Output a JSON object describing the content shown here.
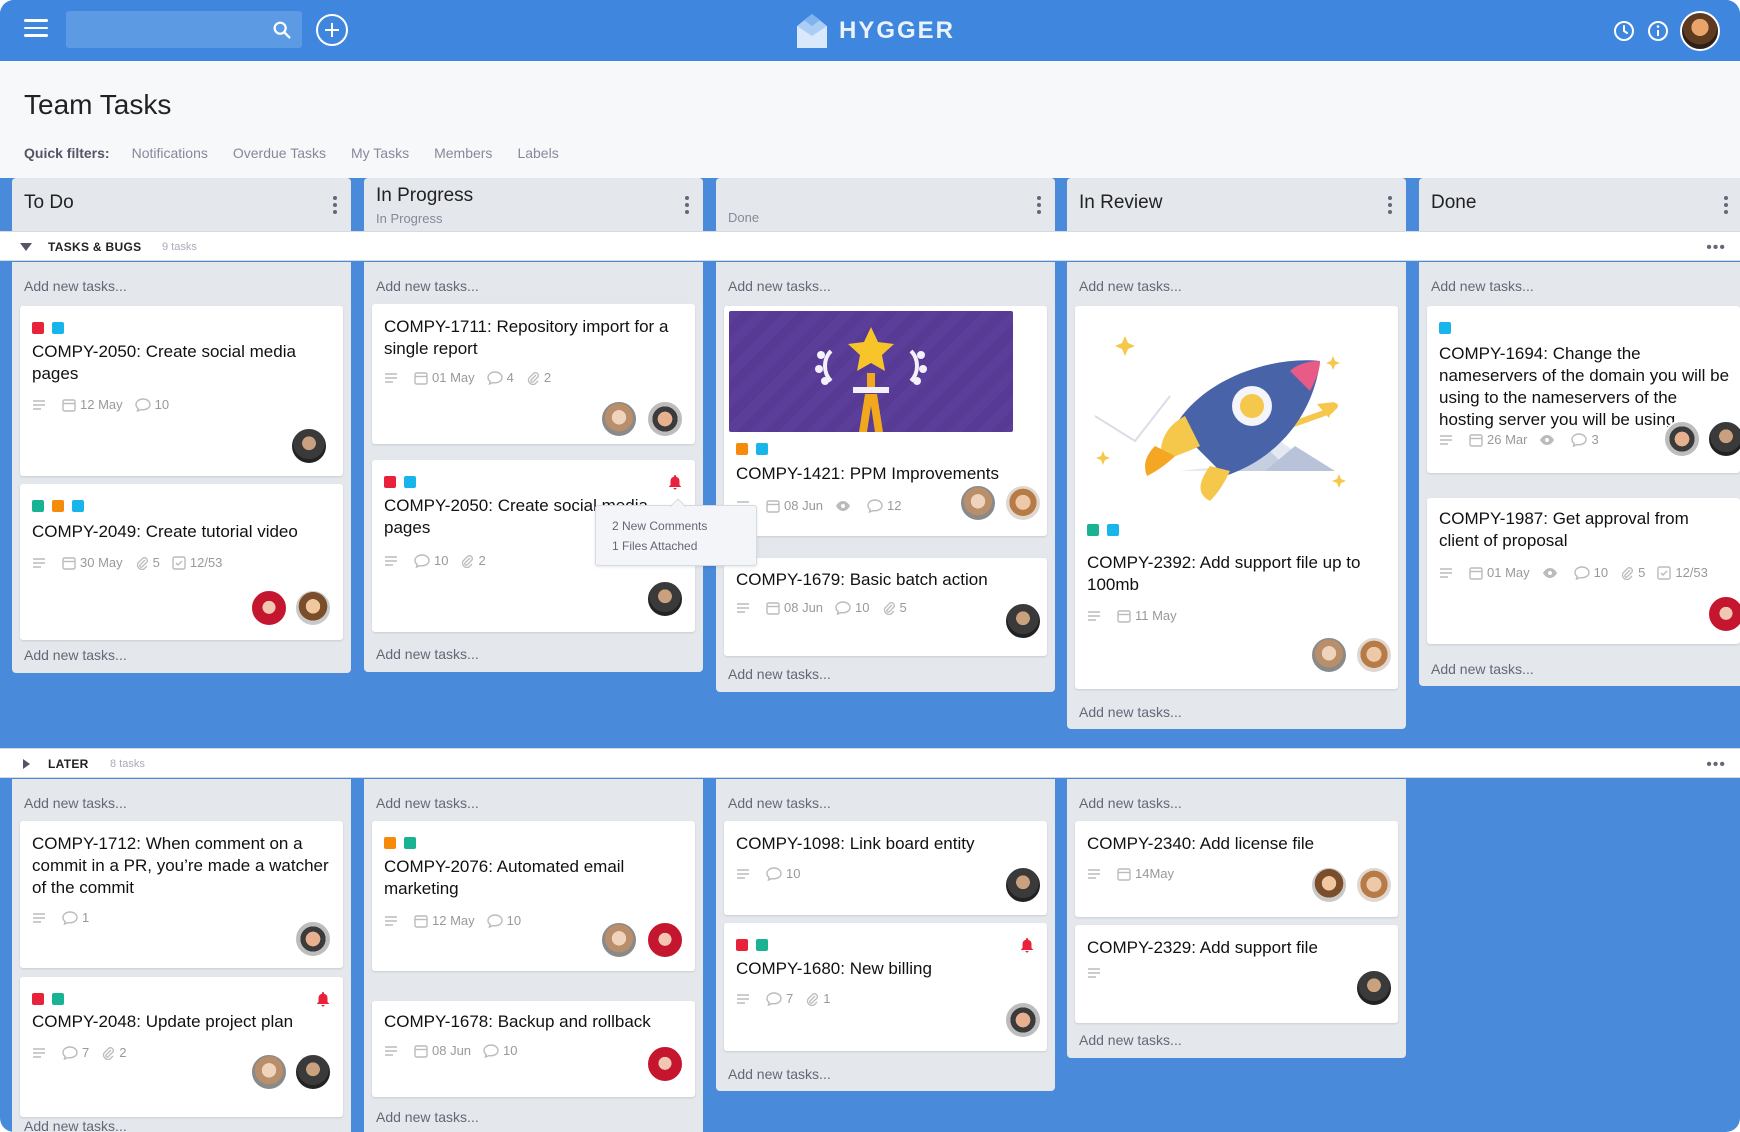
{
  "app": {
    "name": "HYGGER"
  },
  "search": {
    "placeholder": ""
  },
  "page": {
    "title": "Team Tasks"
  },
  "filters": {
    "label": "Quick filters:",
    "items": [
      "Notifications",
      "Overdue Tasks",
      "My Tasks",
      "Members",
      "Labels"
    ]
  },
  "columns": [
    {
      "title": "To Do",
      "subtitle": ""
    },
    {
      "title": "In Progress",
      "subtitle": "In Progress"
    },
    {
      "title": "",
      "subtitle": "Done"
    },
    {
      "title": "In Review",
      "subtitle": ""
    },
    {
      "title": "Done",
      "subtitle": ""
    }
  ],
  "swimlanes": [
    {
      "name": "TASKS & BUGS",
      "count": "9 tasks"
    },
    {
      "name": "LATER",
      "count": "8 tasks"
    }
  ],
  "add_task": "Add new tasks...",
  "tooltip": {
    "line1": "2 New Comments",
    "line2": "1 Files Attached"
  },
  "cards": {
    "c2050": {
      "title": "COMPY-2050: Create social media pages",
      "date": "12 May",
      "comments": "10"
    },
    "c2049": {
      "title": "COMPY-2049: Create tutorial video",
      "date": "30 May",
      "files": "5",
      "checklist": "12/53"
    },
    "c1711": {
      "title": "COMPY-1711: Repository import for a single report",
      "date": "01 May",
      "comments": "4",
      "files": "2"
    },
    "c2050b": {
      "title": "COMPY-2050: Create social media pages",
      "comments": "10",
      "files": "2"
    },
    "c1421": {
      "title": "COMPY-1421: PPM Improvements",
      "date": "08 Jun",
      "comments": "12"
    },
    "c1679": {
      "title": "COMPY-1679: Basic batch action",
      "date": "08 Jun",
      "comments": "10",
      "files": "5"
    },
    "c2392": {
      "title": "COMPY-2392: Add support file up to 100mb",
      "date": "11 May"
    },
    "c1694": {
      "title": "COMPY-1694: Change the nameservers of the domain you will be using to the nameservers of the hosting server you will be using",
      "date": "26 Mar",
      "comments": "3"
    },
    "c1987": {
      "title": "COMPY-1987: Get approval from client of proposal",
      "date": "01 May",
      "comments": "10",
      "files": "5",
      "checklist": "12/53"
    },
    "c1712": {
      "title": "COMPY-1712: When comment on a commit in a PR, you’re made a watcher of the commit",
      "comments": "1"
    },
    "c2048": {
      "title": "COMPY-2048: Update project plan",
      "comments": "7",
      "files": "2"
    },
    "c2076": {
      "title": "COMPY-2076: Automated email marketing",
      "date": "12 May",
      "comments": "10"
    },
    "c1678": {
      "title": "COMPY-1678: Backup and rollback",
      "date": "08 Jun",
      "comments": "10"
    },
    "c1098": {
      "title": "COMPY-1098: Link board entity",
      "comments": "10"
    },
    "c1680": {
      "title": "COMPY-1680: New billing",
      "comments": "7",
      "files": "1"
    },
    "c2340": {
      "title": "COMPY-2340: Add license file",
      "date": "14May"
    },
    "c2329": {
      "title": "COMPY-2329: Add support file"
    }
  },
  "label_colors": {
    "red": "#e9223b",
    "cyan": "#17b5ea",
    "green": "#19b394",
    "orange": "#f58a0b"
  },
  "colors": {
    "topbar": "#3f86de",
    "board_bg": "#4a8ada",
    "column_bg": "#e4e7ec"
  }
}
